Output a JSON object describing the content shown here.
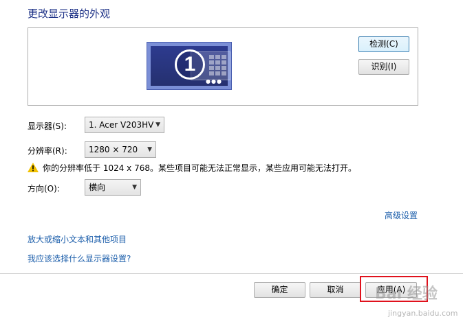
{
  "header": {
    "title": "更改显示器的外观"
  },
  "preview": {
    "monitor_number": "1",
    "detect_button": "检测(C)",
    "identify_button": "识别(I)"
  },
  "settings": {
    "display_label": "显示器(S):",
    "display_value": "1. Acer V203HV",
    "resolution_label": "分辨率(R):",
    "resolution_value": "1280 × 720",
    "warning": "你的分辨率低于 1024 x 768。某些项目可能无法正常显示，某些应用可能无法打开。",
    "orientation_label": "方向(O):",
    "orientation_value": "横向"
  },
  "links": {
    "advanced": "高级设置",
    "text_size": "放大或缩小文本和其他项目",
    "which_settings": "我应该选择什么显示器设置?"
  },
  "footer": {
    "ok": "确定",
    "cancel": "取消",
    "apply": "应用(A)"
  },
  "watermark": {
    "main": "Bai 经验",
    "sub": "jingyan.baidu.com"
  },
  "colors": {
    "title": "#1e3287",
    "link": "#1d5fab",
    "highlight": "#e0111c",
    "warning": "#f2c200"
  }
}
